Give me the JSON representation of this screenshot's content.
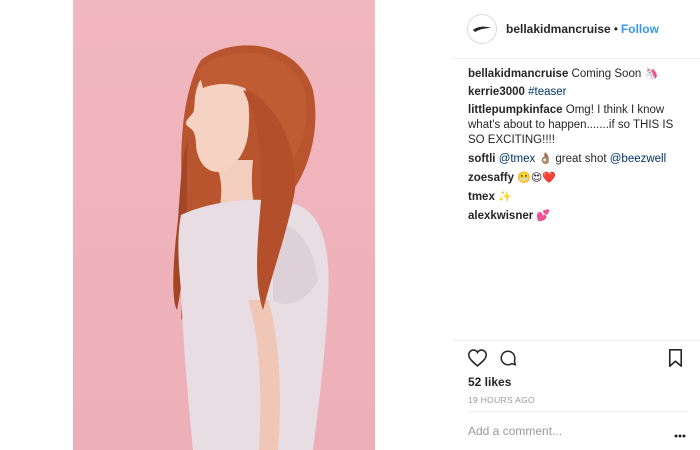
{
  "post": {
    "author": "bellakidmancruise",
    "separator": "•",
    "follow_label": "Follow",
    "logo_icon": "logo-icon"
  },
  "comments": [
    {
      "user": "bellakidmancruise",
      "parts": [
        {
          "text": " Coming Soon "
        },
        {
          "emoji": "🦄"
        }
      ]
    },
    {
      "user": "kerrie3000",
      "parts": [
        {
          "text": " "
        },
        {
          "hashtag": "#teaser"
        }
      ]
    },
    {
      "user": "littlepumpkinface",
      "parts": [
        {
          "text": " Omg! I think I know what's about to happen.......if so THIS IS SO EXCITING!!!!"
        }
      ]
    },
    {
      "user": "softli",
      "parts": [
        {
          "text": " "
        },
        {
          "mention": "@tmex"
        },
        {
          "text": " "
        },
        {
          "emoji": "👌🏽"
        },
        {
          "text": " great shot "
        },
        {
          "mention": "@beezwell"
        }
      ]
    },
    {
      "user": "zoesaffy",
      "parts": [
        {
          "text": " "
        },
        {
          "emoji": "😬😍❤️"
        }
      ]
    },
    {
      "user": "tmex",
      "parts": [
        {
          "text": " "
        },
        {
          "emoji": "✨"
        }
      ]
    },
    {
      "user": "alexkwisner",
      "parts": [
        {
          "text": " "
        },
        {
          "emoji": "💕"
        }
      ]
    }
  ],
  "actions": {
    "like_icon": "heart-icon",
    "comment_icon": "comment-bubble-icon",
    "save_icon": "bookmark-icon"
  },
  "likes_label": "52 likes",
  "time_label": "19 HOURS AGO",
  "add_comment_placeholder": "Add a comment...",
  "more_icon": "more-options-icon",
  "colors": {
    "link": "#3897f0",
    "mention": "#003569",
    "photo_background": "#efb3bb"
  }
}
